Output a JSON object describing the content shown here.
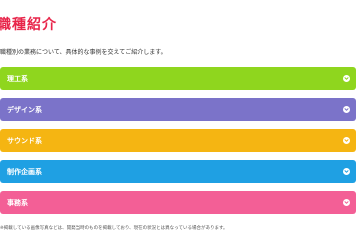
{
  "page": {
    "title": "職種紹介",
    "intro": "職種別の業務について、具体的な事例を交えてご紹介します。",
    "footnote": "※掲載している画像写真などは、開発当時のものを掲載しており、現在の状況とは異なっている場合があります。"
  },
  "categories": [
    {
      "label": "理工系",
      "color": "#8fd61e",
      "icon": "chevron-down-icon"
    },
    {
      "label": "デザイン系",
      "color": "#7b73c9",
      "icon": "chevron-down-icon"
    },
    {
      "label": "サウンド系",
      "color": "#f5b512",
      "icon": "chevron-down-icon"
    },
    {
      "label": "制作企画系",
      "color": "#1fa0e3",
      "icon": "chevron-down-icon"
    },
    {
      "label": "事務系",
      "color": "#f35f96",
      "icon": "chevron-down-icon"
    }
  ]
}
